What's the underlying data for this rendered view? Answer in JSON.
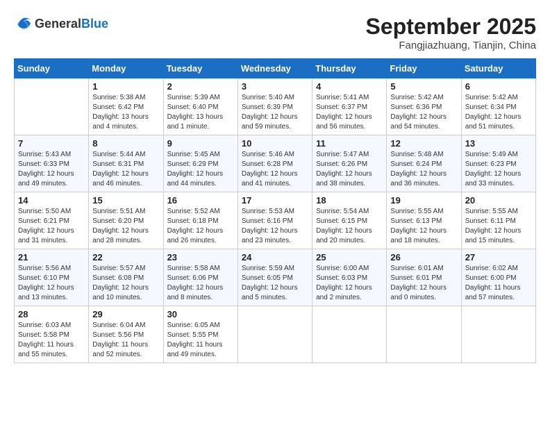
{
  "header": {
    "logo_general": "General",
    "logo_blue": "Blue",
    "month_title": "September 2025",
    "subtitle": "Fangjiazhuang, Tianjin, China"
  },
  "days_of_week": [
    "Sunday",
    "Monday",
    "Tuesday",
    "Wednesday",
    "Thursday",
    "Friday",
    "Saturday"
  ],
  "weeks": [
    [
      {
        "day": "",
        "info": ""
      },
      {
        "day": "1",
        "info": "Sunrise: 5:38 AM\nSunset: 6:42 PM\nDaylight: 13 hours\nand 4 minutes."
      },
      {
        "day": "2",
        "info": "Sunrise: 5:39 AM\nSunset: 6:40 PM\nDaylight: 13 hours\nand 1 minute."
      },
      {
        "day": "3",
        "info": "Sunrise: 5:40 AM\nSunset: 6:39 PM\nDaylight: 12 hours\nand 59 minutes."
      },
      {
        "day": "4",
        "info": "Sunrise: 5:41 AM\nSunset: 6:37 PM\nDaylight: 12 hours\nand 56 minutes."
      },
      {
        "day": "5",
        "info": "Sunrise: 5:42 AM\nSunset: 6:36 PM\nDaylight: 12 hours\nand 54 minutes."
      },
      {
        "day": "6",
        "info": "Sunrise: 5:42 AM\nSunset: 6:34 PM\nDaylight: 12 hours\nand 51 minutes."
      }
    ],
    [
      {
        "day": "7",
        "info": "Sunrise: 5:43 AM\nSunset: 6:33 PM\nDaylight: 12 hours\nand 49 minutes."
      },
      {
        "day": "8",
        "info": "Sunrise: 5:44 AM\nSunset: 6:31 PM\nDaylight: 12 hours\nand 46 minutes."
      },
      {
        "day": "9",
        "info": "Sunrise: 5:45 AM\nSunset: 6:29 PM\nDaylight: 12 hours\nand 44 minutes."
      },
      {
        "day": "10",
        "info": "Sunrise: 5:46 AM\nSunset: 6:28 PM\nDaylight: 12 hours\nand 41 minutes."
      },
      {
        "day": "11",
        "info": "Sunrise: 5:47 AM\nSunset: 6:26 PM\nDaylight: 12 hours\nand 38 minutes."
      },
      {
        "day": "12",
        "info": "Sunrise: 5:48 AM\nSunset: 6:24 PM\nDaylight: 12 hours\nand 36 minutes."
      },
      {
        "day": "13",
        "info": "Sunrise: 5:49 AM\nSunset: 6:23 PM\nDaylight: 12 hours\nand 33 minutes."
      }
    ],
    [
      {
        "day": "14",
        "info": "Sunrise: 5:50 AM\nSunset: 6:21 PM\nDaylight: 12 hours\nand 31 minutes."
      },
      {
        "day": "15",
        "info": "Sunrise: 5:51 AM\nSunset: 6:20 PM\nDaylight: 12 hours\nand 28 minutes."
      },
      {
        "day": "16",
        "info": "Sunrise: 5:52 AM\nSunset: 6:18 PM\nDaylight: 12 hours\nand 26 minutes."
      },
      {
        "day": "17",
        "info": "Sunrise: 5:53 AM\nSunset: 6:16 PM\nDaylight: 12 hours\nand 23 minutes."
      },
      {
        "day": "18",
        "info": "Sunrise: 5:54 AM\nSunset: 6:15 PM\nDaylight: 12 hours\nand 20 minutes."
      },
      {
        "day": "19",
        "info": "Sunrise: 5:55 AM\nSunset: 6:13 PM\nDaylight: 12 hours\nand 18 minutes."
      },
      {
        "day": "20",
        "info": "Sunrise: 5:55 AM\nSunset: 6:11 PM\nDaylight: 12 hours\nand 15 minutes."
      }
    ],
    [
      {
        "day": "21",
        "info": "Sunrise: 5:56 AM\nSunset: 6:10 PM\nDaylight: 12 hours\nand 13 minutes."
      },
      {
        "day": "22",
        "info": "Sunrise: 5:57 AM\nSunset: 6:08 PM\nDaylight: 12 hours\nand 10 minutes."
      },
      {
        "day": "23",
        "info": "Sunrise: 5:58 AM\nSunset: 6:06 PM\nDaylight: 12 hours\nand 8 minutes."
      },
      {
        "day": "24",
        "info": "Sunrise: 5:59 AM\nSunset: 6:05 PM\nDaylight: 12 hours\nand 5 minutes."
      },
      {
        "day": "25",
        "info": "Sunrise: 6:00 AM\nSunset: 6:03 PM\nDaylight: 12 hours\nand 2 minutes."
      },
      {
        "day": "26",
        "info": "Sunrise: 6:01 AM\nSunset: 6:01 PM\nDaylight: 12 hours\nand 0 minutes."
      },
      {
        "day": "27",
        "info": "Sunrise: 6:02 AM\nSunset: 6:00 PM\nDaylight: 11 hours\nand 57 minutes."
      }
    ],
    [
      {
        "day": "28",
        "info": "Sunrise: 6:03 AM\nSunset: 5:58 PM\nDaylight: 11 hours\nand 55 minutes."
      },
      {
        "day": "29",
        "info": "Sunrise: 6:04 AM\nSunset: 5:56 PM\nDaylight: 11 hours\nand 52 minutes."
      },
      {
        "day": "30",
        "info": "Sunrise: 6:05 AM\nSunset: 5:55 PM\nDaylight: 11 hours\nand 49 minutes."
      },
      {
        "day": "",
        "info": ""
      },
      {
        "day": "",
        "info": ""
      },
      {
        "day": "",
        "info": ""
      },
      {
        "day": "",
        "info": ""
      }
    ]
  ]
}
